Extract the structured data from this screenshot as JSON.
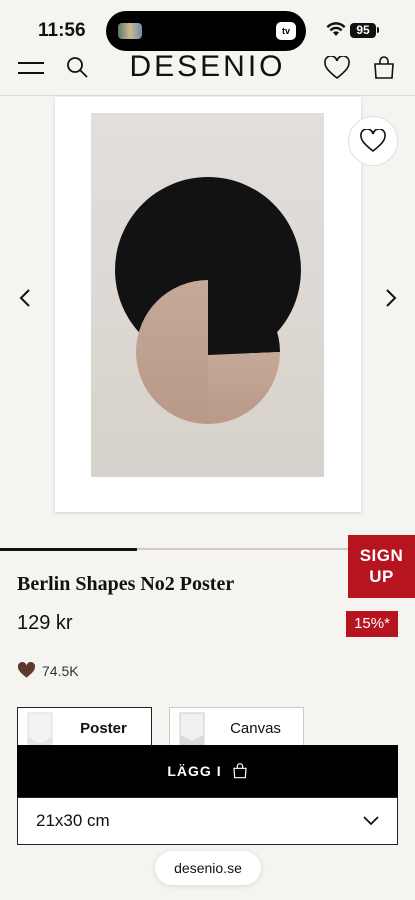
{
  "status_bar": {
    "time": "11:56",
    "battery": "95",
    "island_app": "tv"
  },
  "header": {
    "logo": "DESENIO"
  },
  "product": {
    "title": "Berlin Shapes No2 Poster",
    "price": "129 kr",
    "discount": "15%*",
    "likes": "74.5K",
    "gallery_progress": 0.33
  },
  "signup": {
    "label": "SIGN UP"
  },
  "format_options": [
    {
      "label": "Poster",
      "selected": true
    },
    {
      "label": "Canvas",
      "selected": false
    }
  ],
  "cart": {
    "label": "LÄGG I"
  },
  "size_select": {
    "value": "21x30 cm"
  },
  "browser": {
    "url": "desenio.se"
  },
  "colors": {
    "accent_red": "#b6141f",
    "black": "#000000",
    "background": "#f6f4f1"
  }
}
